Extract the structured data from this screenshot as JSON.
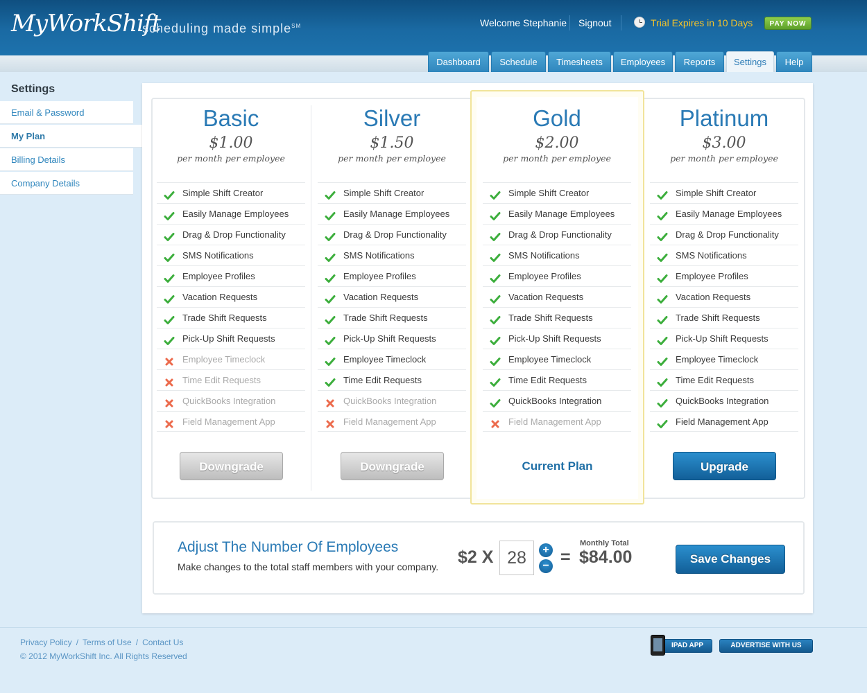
{
  "header": {
    "logo_text": "MyWorkShift",
    "tagline": "scheduling made simple",
    "tagline_mark": "SM",
    "welcome": "Welcome Stephanie",
    "signout": "Signout",
    "trial": "Trial Expires in 10 Days",
    "pay_now": "PAY NOW",
    "colors": {
      "trial": "#f5c32a",
      "pay_now": "#6ab236"
    }
  },
  "tabs": [
    {
      "label": "Dashboard",
      "active": false
    },
    {
      "label": "Schedule",
      "active": false
    },
    {
      "label": "Timesheets",
      "active": false
    },
    {
      "label": "Employees",
      "active": false
    },
    {
      "label": "Reports",
      "active": false
    },
    {
      "label": "Settings",
      "active": true
    },
    {
      "label": "Help",
      "active": false
    }
  ],
  "sidebar": {
    "title": "Settings",
    "items": [
      {
        "label": "Email & Password",
        "active": false
      },
      {
        "label": "My Plan",
        "active": true
      },
      {
        "label": "Billing Details",
        "active": false
      },
      {
        "label": "Company Details",
        "active": false
      }
    ]
  },
  "plans": [
    {
      "name": "Basic",
      "price": "$1.00",
      "per": "per month per employee",
      "button": "Downgrade",
      "button_style": "grey",
      "features": [
        {
          "label": "Simple Shift Creator",
          "included": true
        },
        {
          "label": "Easily Manage Employees",
          "included": true
        },
        {
          "label": "Drag & Drop Functionality",
          "included": true
        },
        {
          "label": "SMS Notifications",
          "included": true
        },
        {
          "label": "Employee Profiles",
          "included": true
        },
        {
          "label": "Vacation Requests",
          "included": true
        },
        {
          "label": "Trade Shift Requests",
          "included": true
        },
        {
          "label": "Pick-Up Shift Requests",
          "included": true
        },
        {
          "label": "Employee Timeclock",
          "included": false
        },
        {
          "label": "Time Edit Requests",
          "included": false
        },
        {
          "label": "QuickBooks Integration",
          "included": false
        },
        {
          "label": "Field Management App",
          "included": false
        }
      ]
    },
    {
      "name": "Silver",
      "price": "$1.50",
      "per": "per month per employee",
      "button": "Downgrade",
      "button_style": "grey",
      "features": [
        {
          "label": "Simple Shift Creator",
          "included": true
        },
        {
          "label": "Easily Manage Employees",
          "included": true
        },
        {
          "label": "Drag & Drop Functionality",
          "included": true
        },
        {
          "label": "SMS Notifications",
          "included": true
        },
        {
          "label": "Employee Profiles",
          "included": true
        },
        {
          "label": "Vacation Requests",
          "included": true
        },
        {
          "label": "Trade Shift Requests",
          "included": true
        },
        {
          "label": "Pick-Up Shift Requests",
          "included": true
        },
        {
          "label": "Employee Timeclock",
          "included": true
        },
        {
          "label": "Time Edit Requests",
          "included": true
        },
        {
          "label": "QuickBooks Integration",
          "included": false
        },
        {
          "label": "Field Management App",
          "included": false
        }
      ]
    },
    {
      "name": "Gold",
      "price": "$2.00",
      "per": "per month per employee",
      "button": "Current Plan",
      "button_style": "current",
      "features": [
        {
          "label": "Simple Shift Creator",
          "included": true
        },
        {
          "label": "Easily Manage Employees",
          "included": true
        },
        {
          "label": "Drag & Drop Functionality",
          "included": true
        },
        {
          "label": "SMS Notifications",
          "included": true
        },
        {
          "label": "Employee Profiles",
          "included": true
        },
        {
          "label": "Vacation Requests",
          "included": true
        },
        {
          "label": "Trade Shift Requests",
          "included": true
        },
        {
          "label": "Pick-Up Shift Requests",
          "included": true
        },
        {
          "label": "Employee Timeclock",
          "included": true
        },
        {
          "label": "Time Edit Requests",
          "included": true
        },
        {
          "label": "QuickBooks Integration",
          "included": true
        },
        {
          "label": "Field Management App",
          "included": false
        }
      ]
    },
    {
      "name": "Platinum",
      "price": "$3.00",
      "per": "per month per employee",
      "button": "Upgrade",
      "button_style": "blue",
      "features": [
        {
          "label": "Simple Shift Creator",
          "included": true
        },
        {
          "label": "Easily Manage Employees",
          "included": true
        },
        {
          "label": "Drag & Drop Functionality",
          "included": true
        },
        {
          "label": "SMS Notifications",
          "included": true
        },
        {
          "label": "Employee Profiles",
          "included": true
        },
        {
          "label": "Vacation Requests",
          "included": true
        },
        {
          "label": "Trade Shift Requests",
          "included": true
        },
        {
          "label": "Pick-Up Shift Requests",
          "included": true
        },
        {
          "label": "Employee Timeclock",
          "included": true
        },
        {
          "label": "Time Edit Requests",
          "included": true
        },
        {
          "label": "QuickBooks Integration",
          "included": true
        },
        {
          "label": "Field Management App",
          "included": true
        }
      ]
    }
  ],
  "adjust": {
    "title": "Adjust The Number Of Employees",
    "subtitle": "Make changes to the total staff members with your company.",
    "multiplier": "$2 X",
    "employees": "28",
    "plus": "+",
    "minus": "−",
    "equals": "=",
    "total_label": "Monthly Total",
    "total_value": "$84.00",
    "save": "Save Changes"
  },
  "footer": {
    "links": [
      "Privacy Policy",
      "Terms of Use",
      "Contact Us"
    ],
    "copyright": "© 2012 MyWorkShift Inc.  All Rights Reserved",
    "ipad": "IPAD APP",
    "advertise": "ADVERTISE WITH US"
  },
  "icons": {
    "included": "check-icon",
    "excluded": "cross-icon",
    "ipad": "ipad-icon",
    "clock": "clock-icon"
  }
}
